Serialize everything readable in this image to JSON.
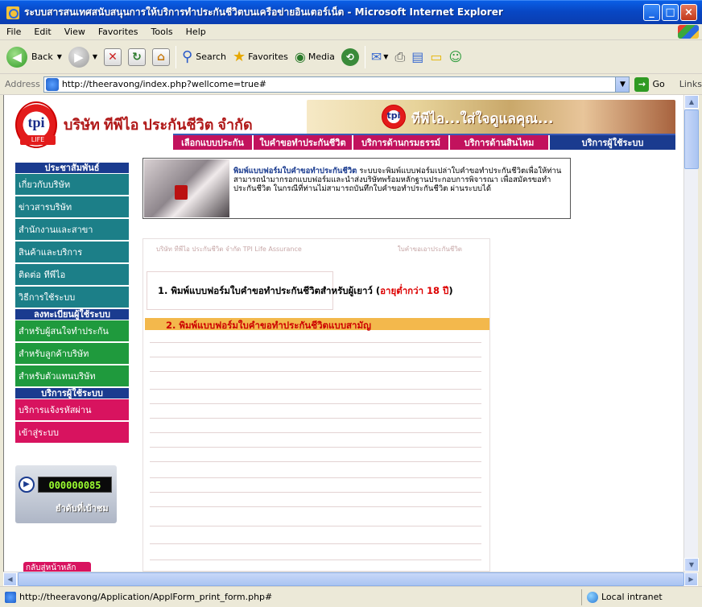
{
  "window": {
    "title": "ระบบสารสนเทศสนับสนุนการให้บริการทำประกันชีวิตบนเครือข่ายอินเตอร์เน็ต - Microsoft Internet Explorer"
  },
  "menu": [
    "File",
    "Edit",
    "View",
    "Favorites",
    "Tools",
    "Help"
  ],
  "toolbar": {
    "back": "Back",
    "search": "Search",
    "favorites": "Favorites",
    "media": "Media"
  },
  "address": {
    "label": "Address",
    "url": "http://theeravong/index.php?wellcome=true#",
    "go": "Go",
    "links": "Links"
  },
  "site": {
    "company": "บริษัท ทีพีไอ ประกันชีวิต จำกัด",
    "logo_text": "tpi",
    "logo_sub": "LIFE",
    "slogan": "ทีพีไอ...ใส่ใจดูแลคุณ...",
    "nav": [
      "เลือกแบบประกัน",
      "ใบคำขอทำประกันชีวิต",
      "บริการด้านกรมธรรม์",
      "บริการด้านสินไหม",
      "บริการผู้ใช้ระบบ"
    ]
  },
  "sidebar": {
    "pr_header": "ประชาสัมพันธ์",
    "pr_items": [
      "เกี่ยวกับบริษัท",
      "ข่าวสารบริษัท",
      "สำนักงานและสาขา",
      "สินค้าและบริการ",
      "ติดต่อ ทีพีไอ",
      "วิธีการใช้ระบบ"
    ],
    "reg_header": "ลงทะเบียนผู้ใช้ระบบ",
    "reg_items": [
      "สำหรับผู้สนใจทำประกัน",
      "สำหรับลูกค้าบริษัท",
      "สำหรับตัวแทนบริษัท"
    ],
    "svc_header": "บริการผู้ใช้ระบบ",
    "svc_items": [
      "บริการแจ้งรหัสผ่าน",
      "เข้าสู่ระบบ"
    ],
    "counter_value": "000000085",
    "counter_label": "ยำดับที่เบ้าชม",
    "back_home": "กลับสู่หน้าหลัก"
  },
  "promo": {
    "heading": "พิมพ์แบบฟอร์มใบคำขอทำประกันชีวิต",
    "body": "ระบบจะพิมพ์แบบฟอร์มเปล่าใบคำขอทำประกันชีวิตเพื่อให้ท่านสามารถนำมากรอกแบบฟอร์มและนำส่งบริษัทพร้อมหลักฐานประกอบการพิจารณา เพื่อสมัครขอทำประกันชีวิต ในกรณีที่ท่านไม่สามารถบันทึกใบคำขอทำประกันชีวิต ผ่านระบบได้"
  },
  "form": {
    "header_left": "บริษัท ทีพีไอ ประกันชีวิต จำกัด TPI Life Assurance",
    "header_right": "ใบคำขอเอาประกันชีวิต",
    "option1_text": "1. พิมพ์แบบฟอร์มใบคำขอทำประกันชีวิตสำหรับผู้เยาว์ (",
    "option1_red": "อายุต่ำกว่า 18 ปี",
    "option1_close": ")",
    "option2_text": "2. พิมพ์แบบฟอร์มใบคำขอทำประกันชีวิตแบบสามัญ"
  },
  "status": {
    "url": "http://theeravong/Application/ApplForm_print_form.php#",
    "zone": "Local intranet"
  },
  "colors": {
    "nav_red": "#c2125d",
    "nav_blue": "#1a3b8f",
    "side_teal": "#1c7f88",
    "side_green": "#1f9a3d",
    "side_pink": "#d8135f"
  }
}
